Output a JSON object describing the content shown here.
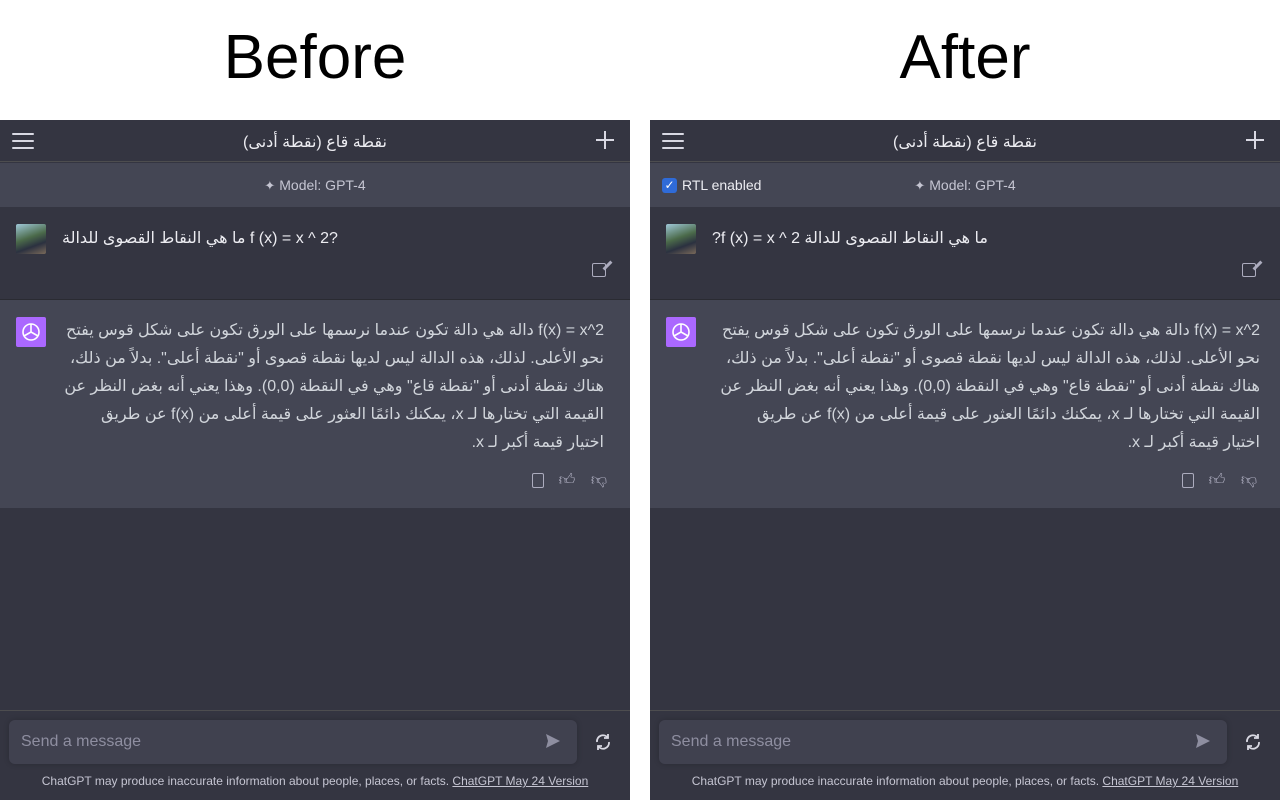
{
  "headings": {
    "before": "Before",
    "after": "After"
  },
  "conversation": {
    "title": "نقطة قاع (نقطة أدنى)",
    "model_label": "Model: GPT-4",
    "rtl_label": "RTL enabled",
    "user_message_before": "ما هي النقاط القصوى للدالة f (x) = x ^ 2?",
    "user_message_after": "ما هي النقاط القصوى للدالة f (x) = x ^ 2?",
    "assistant_message": "هي دالة تكون عندما نرسمها على الورق تكون على شكل قوس يفتح نحو الأعلى. لذلك، هذه الدالة ليس لديها نقطة قصوى أو \"نقطة أعلى\". بدلاً من ذلك، هناك نقطة أدنى أو \"نقطة قاع\" وهي في النقطة (0,0). وهذا يعني أنه بغض النظر عن القيمة التي تختارها لـ x، يمكنك دائمًا العثور على قيمة أعلى من f(x) عن طريق اختيار قيمة أكبر لـ x.",
    "assistant_message_prefix": "f(x) = x^2 دالة"
  },
  "composer": {
    "placeholder": "Send a message",
    "disclaimer": "ChatGPT may produce inaccurate information about people, places, or facts.",
    "version_link": "ChatGPT May 24 Version"
  },
  "icons": [
    "menu-icon",
    "plus-icon",
    "sparkle-icon",
    "edit-icon",
    "openai-logo-icon",
    "clipboard-icon",
    "thumbs-up-icon",
    "thumbs-down-icon",
    "send-icon",
    "refresh-icon",
    "checkbox-icon"
  ],
  "colors": {
    "panel_bg": "#343541",
    "assistant_bg": "#444654",
    "input_bg": "#40414f",
    "logo_purple": "#ab68ff",
    "checkbox_blue": "#2f6bd8"
  }
}
